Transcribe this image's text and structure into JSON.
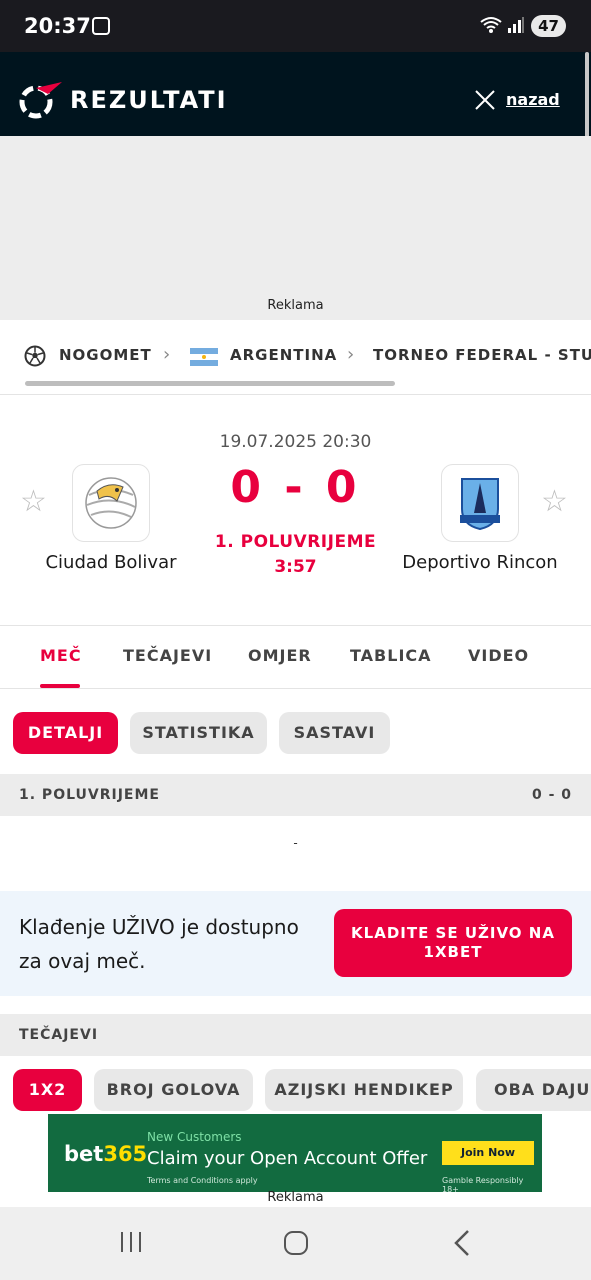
{
  "status_bar": {
    "time": "20:37",
    "battery": "47"
  },
  "header": {
    "brand": "REZULTATI",
    "back_label": "nazad"
  },
  "ad_top": {
    "label": "Reklama"
  },
  "breadcrumb": [
    {
      "label": "NOGOMET",
      "icon": "soccer-ball-icon"
    },
    {
      "label": "ARGENTINA",
      "icon": "argentina-flag-icon"
    },
    {
      "label": "TORNEO FEDERAL - STU"
    }
  ],
  "match": {
    "datetime": "19.07.2025 20:30",
    "score": "0 - 0",
    "status": "1. POLUVRIJEME",
    "clock": "3:57",
    "home": {
      "name": "Ciudad Bolivar"
    },
    "away": {
      "name": "Deportivo Rincon"
    }
  },
  "tabs": [
    "MEČ",
    "TEČAJEVI",
    "OMJER",
    "TABLICA",
    "VIDEO"
  ],
  "subtabs": [
    "DETALJI",
    "STATISTIKA",
    "SASTAVI"
  ],
  "period": {
    "label": "1. POLUVRIJEME",
    "score": "0 - 0",
    "empty": "-"
  },
  "live_betting": {
    "text": "Klađenje UŽIVO je dostupno za ovaj meč.",
    "button": "KLADITE SE UŽIVO NA 1XBET"
  },
  "odds_section": {
    "title": "TEČAJEVI",
    "chips": [
      "1X2",
      "BROJ GOLOVA",
      "AZIJSKI HENDIKEP",
      "OBA DAJU G"
    ]
  },
  "ad_bottom": {
    "brand_a": "bet",
    "brand_b": "365",
    "new_customers": "New Customers",
    "headline": "Claim your Open Account Offer",
    "terms": "Terms and Conditions apply",
    "join": "Join Now",
    "gamble": "Gamble Responsibly  18+",
    "label": "Reklama"
  },
  "colors": {
    "accent": "#e8003e",
    "header_bg": "#00141e"
  }
}
